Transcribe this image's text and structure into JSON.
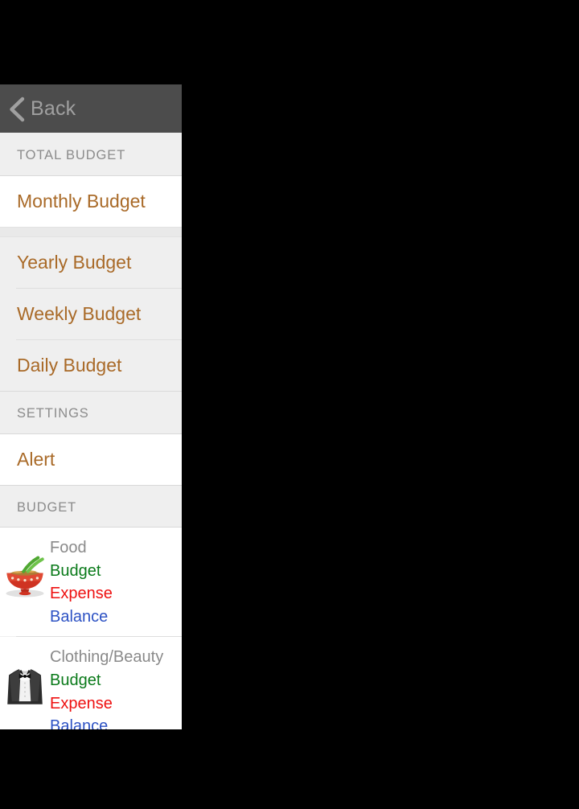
{
  "window": {
    "background_color": "#000000",
    "panel_background": "#efefef"
  },
  "navbar": {
    "back_label": "Back",
    "back_icon": "chevron-left-icon",
    "background_color": "#4c4c4c",
    "text_color": "#a0a0a0"
  },
  "sections": {
    "total_budget_header": "TOTAL BUDGET",
    "settings_header": "SETTINGS",
    "budget_header": "BUDGET"
  },
  "menu": {
    "accent_color": "#a96a28",
    "total_budget_items": [
      {
        "label": "Monthly Budget"
      },
      {
        "label": "Yearly Budget"
      },
      {
        "label": "Weekly Budget"
      },
      {
        "label": "Daily Budget"
      }
    ],
    "settings_items": [
      {
        "label": "Alert"
      }
    ]
  },
  "budget_items": [
    {
      "title": "Food",
      "icon": "ramen-bowl-icon",
      "budget_label": "Budget",
      "expense_label": "Expense",
      "balance_label": "Balance"
    },
    {
      "title": "Clothing/Beauty",
      "icon": "tuxedo-icon",
      "budget_label": "Budget",
      "expense_label": "Expense",
      "balance_label": "Balance"
    }
  ],
  "colors": {
    "title_gray": "#8a8a8a",
    "budget_green": "#0a7a1a",
    "expense_red": "#ee1111",
    "balance_blue": "#2d52c4"
  }
}
